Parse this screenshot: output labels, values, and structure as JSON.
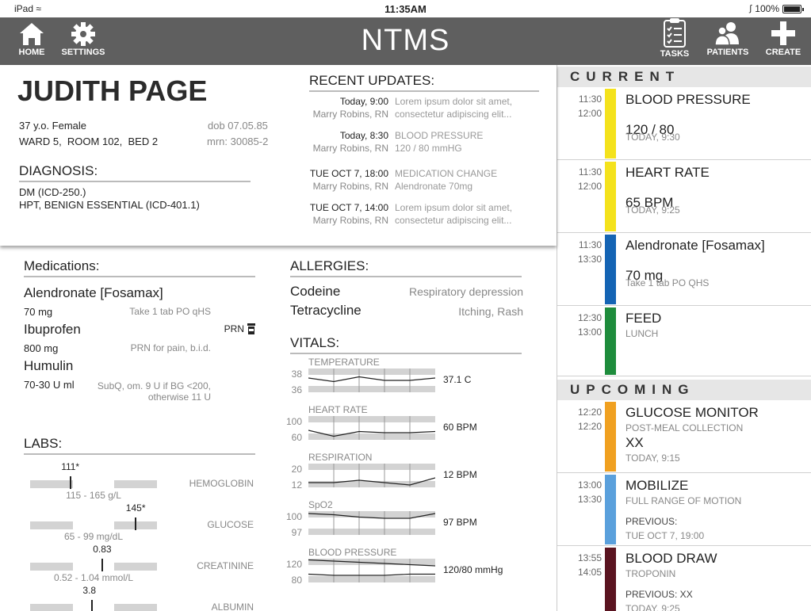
{
  "status_bar": {
    "device": "iPad",
    "time": "11:35AM",
    "battery": "100%"
  },
  "nav": {
    "title": "NTMS",
    "home_label": "HOME",
    "settings_label": "SETTINGS",
    "tasks_label": "TASKS",
    "patients_label": "PATIENTS",
    "create_label": "CREATE"
  },
  "patient": {
    "name": "JUDITH PAGE",
    "age_sex": "37 y.o. Female",
    "dob": "dob 07.05.85",
    "location": "WARD 5,  ROOM 102,  BED 2",
    "mrn": "mrn: 30085-2"
  },
  "diagnosis": {
    "heading": "DIAGNOSIS:",
    "items": [
      "DM (ICD-250.)",
      "HPT, BENIGN ESSENTIAL (ICD-401.1)"
    ]
  },
  "updates": {
    "heading": "RECENT UPDATES:",
    "items": [
      {
        "when": "Today, 9:00",
        "who": "Marry Robins, RN",
        "line1": "Lorem ipsum dolor sit amet,",
        "line2": "consectetur adipiscing elit..."
      },
      {
        "when": "Today, 8:30",
        "who": "Marry Robins, RN",
        "line1": "BLOOD PRESSURE",
        "line2": "120 / 80 mmHG"
      },
      {
        "when": "TUE OCT 7, 18:00",
        "who": "Marry Robins, RN",
        "line1": "MEDICATION CHANGE",
        "line2": "Alendronate 70mg"
      },
      {
        "when": "TUE OCT 7, 14:00",
        "who": "Marry Robins, RN",
        "line1": "Lorem ipsum dolor sit amet,",
        "line2": "consectetur adipiscing elit..."
      }
    ]
  },
  "medications": {
    "heading": "Medications:",
    "items": [
      {
        "name": "Alendronate [Fosamax]",
        "dose": "70 mg",
        "instr": "Take 1 tab PO qHS"
      },
      {
        "name": "Ibuprofen",
        "dose": "800 mg",
        "instr": "PRN for pain, b.i.d.",
        "badge": "PRN"
      },
      {
        "name": "Humulin",
        "dose": "70-30 U ml",
        "instr1": "SubQ, om. 9 U if BG <200,",
        "instr2": "otherwise 11 U"
      }
    ]
  },
  "allergies": {
    "heading": "ALLERGIES:",
    "items": [
      {
        "name": "Codeine",
        "reaction": "Respiratory depression"
      },
      {
        "name": "Tetracycline",
        "reaction": "Itching, Rash"
      }
    ]
  },
  "labs": {
    "heading": "LABS:",
    "items": [
      {
        "name": "HEMOGLOBIN",
        "value": "111*",
        "range": "115 - 165 g/L",
        "position": 0.32
      },
      {
        "name": "GLUCOSE",
        "value": "145*",
        "range": "65 - 99 mg/dL",
        "position": 0.83
      },
      {
        "name": "CREATININE",
        "value": "0.83",
        "range": "0.52 - 1.04 mmol/L",
        "position": 0.57
      },
      {
        "name": "ALBUMIN",
        "value": "3.8",
        "position": 0.49
      }
    ]
  },
  "vitals": {
    "heading": "VITALS:",
    "items": [
      {
        "label": "TEMPERATURE",
        "axis_high": "38",
        "axis_low": "36",
        "value": "37.1 C",
        "trend": [
          0.6,
          0.45,
          0.65,
          0.5,
          0.5,
          0.6
        ]
      },
      {
        "label": "HEART RATE",
        "axis_high": "100",
        "axis_low": "60",
        "value": "60 BPM",
        "trend": [
          0.4,
          0.15,
          0.35,
          0.3,
          0.3,
          0.35
        ]
      },
      {
        "label": "RESPIRATION",
        "axis_high": "20",
        "axis_low": "12",
        "value": "12 BPM",
        "trend": [
          0.2,
          0.2,
          0.3,
          0.2,
          0.1,
          0.4
        ]
      },
      {
        "label": "SpO2",
        "axis_high": "100",
        "axis_low": "97",
        "value": "97 BPM",
        "trend": [
          0.9,
          0.85,
          0.75,
          0.7,
          0.7,
          0.9
        ]
      },
      {
        "label": "BLOOD PRESSURE",
        "axis_high": "120",
        "axis_low": "80",
        "value": "120/80 mmHg",
        "trend": [
          0.95,
          0.9,
          0.85,
          0.8,
          0.75,
          0.7
        ],
        "trend2": [
          0.35,
          0.3,
          0.3,
          0.3,
          0.35,
          0.35
        ]
      }
    ]
  },
  "schedule": {
    "current_heading": "CURRENT",
    "upcoming_heading": "UPCOMING",
    "current": [
      {
        "start": "11:30",
        "end": "12:00",
        "title": "BLOOD PRESSURE",
        "big": "120 / 80",
        "sub": "TODAY, 9:30",
        "color": "#f4e21c"
      },
      {
        "start": "11:30",
        "end": "12:00",
        "title": "HEART RATE",
        "big": "65 BPM",
        "sub": "TODAY, 9:25",
        "color": "#f4e21c"
      },
      {
        "start": "11:30",
        "end": "13:30",
        "title": "Alendronate [Fosamax]",
        "big": "70 mg",
        "sub": "Take 1 tab PO QHS",
        "color": "#1464b4"
      },
      {
        "start": "12:30",
        "end": "13:00",
        "title": "FEED",
        "detail": "LUNCH",
        "color": "#1e8c3c"
      }
    ],
    "upcoming": [
      {
        "start": "12:20",
        "end": "12:20",
        "title": "GLUCOSE MONITOR",
        "detail": "POST-MEAL COLLECTION",
        "big": "XX",
        "sub": "TODAY, 9:15",
        "color": "#f0a020"
      },
      {
        "start": "13:00",
        "end": "13:30",
        "title": "MOBILIZE",
        "detail": "FULL RANGE OF MOTION",
        "prev_label": "PREVIOUS:",
        "sub": "TUE OCT 7, 19:00",
        "color": "#5aa0dc"
      },
      {
        "start": "13:55",
        "end": "14:05",
        "title": "BLOOD DRAW",
        "detail": "TROPONIN",
        "prev_label": "PREVIOUS: XX",
        "sub": "TODAY, 9:25",
        "color": "#5a1420"
      }
    ]
  }
}
